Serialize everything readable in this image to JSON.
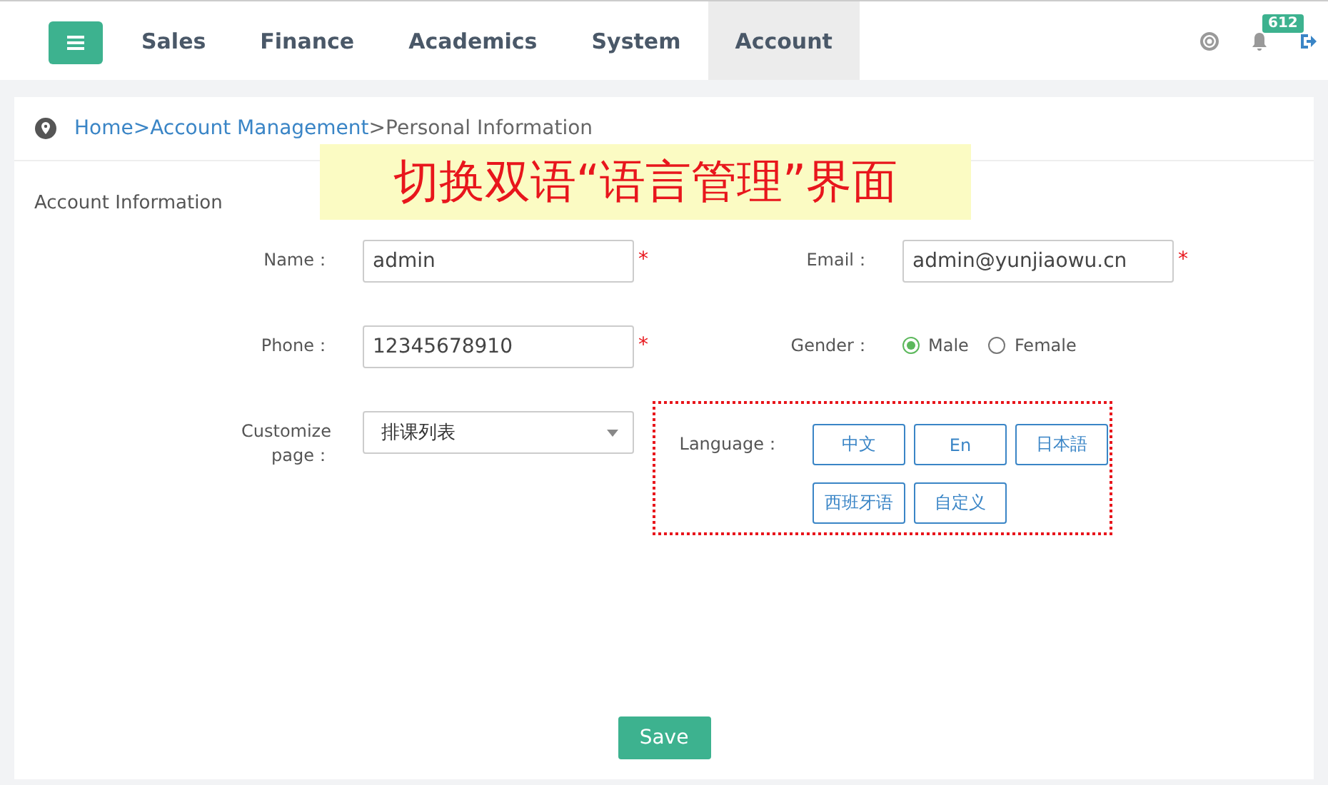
{
  "nav": {
    "tabs": [
      {
        "label": "Sales",
        "selected": false
      },
      {
        "label": "Finance",
        "selected": false
      },
      {
        "label": "Academics",
        "selected": false
      },
      {
        "label": "System",
        "selected": false
      },
      {
        "label": "Account",
        "selected": true
      }
    ],
    "notification_count": "612"
  },
  "breadcrumb": [
    {
      "label": "Home",
      "kind": "link"
    },
    {
      "label": ">Account Management",
      "kind": "link"
    },
    {
      "label": ">Personal Information",
      "kind": "text"
    }
  ],
  "annotation": "切换双语“语言管理”界面",
  "section_title": "Account Information",
  "left_fields": [
    {
      "label": "Name：",
      "value": "admin",
      "kind": "input",
      "required_mark": "*"
    },
    {
      "label": "Phone：",
      "value": "12345678910",
      "kind": "input",
      "required_mark": "*"
    },
    {
      "label": "Customize page：",
      "value": "排课列表",
      "kind": "select"
    }
  ],
  "email": {
    "label": "Email：",
    "value": "admin@yunjiaowu.cn",
    "required_mark": "*"
  },
  "gender": {
    "label": "Gender：",
    "options": [
      {
        "label": "Male",
        "selected": true
      },
      {
        "label": "Female",
        "selected": false
      }
    ]
  },
  "language": {
    "label": "Language：",
    "options": [
      "中文",
      "En",
      "日本語",
      "西班牙语",
      "自定义"
    ]
  },
  "save_button": "Save"
}
